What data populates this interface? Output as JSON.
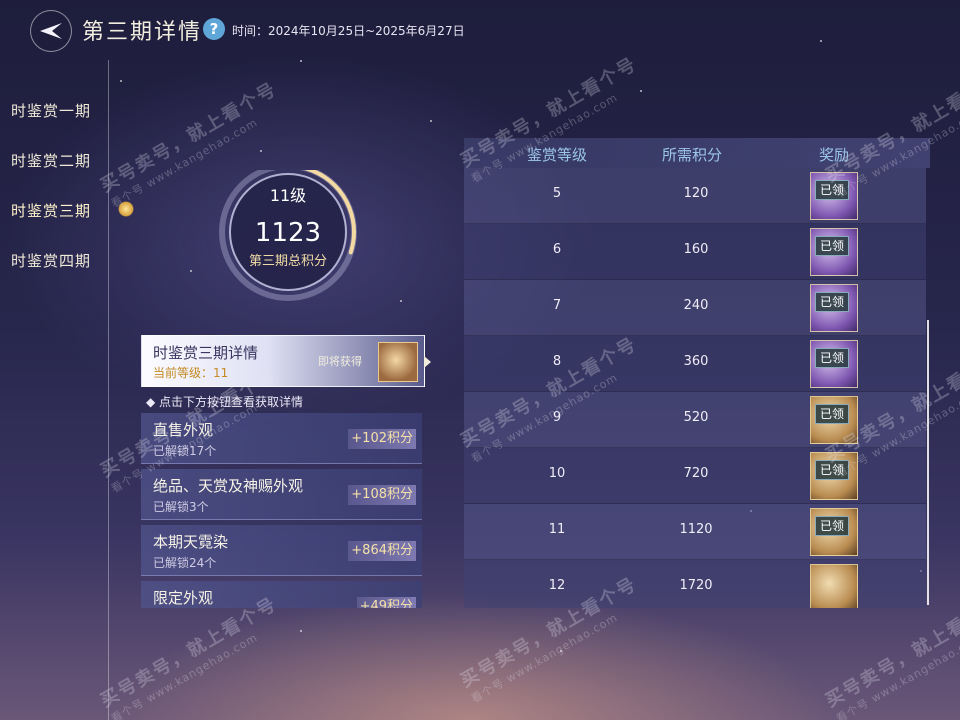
{
  "header": {
    "title": "第三期详情",
    "help_icon": "question-mark-icon",
    "period": "时间：2024年10月25日~2025年6月27日"
  },
  "nav": {
    "items": [
      {
        "label": "时鉴赏一期"
      },
      {
        "label": "时鉴赏二期"
      },
      {
        "label": "时鉴赏三期"
      },
      {
        "label": "时鉴赏四期"
      }
    ],
    "active_index": 2
  },
  "score": {
    "level": "11级",
    "value": "1123",
    "caption": "第三期总积分",
    "ring_progress": 0.3
  },
  "summary": {
    "title": "时鉴赏三期详情",
    "subtitle": "当前等级：11",
    "upcoming_label": "即将获得"
  },
  "hint": "点击下方按钮查看获取详情",
  "sources": [
    {
      "name": "直售外观",
      "unlocked": "已解锁17个",
      "points": "+102积分"
    },
    {
      "name": "绝品、天赏及神赐外观",
      "unlocked": "已解锁3个",
      "points": "+108积分"
    },
    {
      "name": "本期天霓染",
      "unlocked": "已解锁24个",
      "points": "+864积分"
    },
    {
      "name": "限定外观",
      "unlocked": "",
      "points": "+49积分"
    }
  ],
  "table": {
    "headers": [
      "鉴赏等级",
      "所需积分",
      "奖励"
    ],
    "rows": [
      {
        "level": "5",
        "points": "120",
        "reward": "purple",
        "status": "已领"
      },
      {
        "level": "6",
        "points": "160",
        "reward": "purple",
        "status": "已领"
      },
      {
        "level": "7",
        "points": "240",
        "reward": "purple",
        "status": "已领"
      },
      {
        "level": "8",
        "points": "360",
        "reward": "purple",
        "status": "已领"
      },
      {
        "level": "9",
        "points": "520",
        "reward": "gold",
        "status": "已领"
      },
      {
        "level": "10",
        "points": "720",
        "reward": "gold",
        "status": "已领"
      },
      {
        "level": "11",
        "points": "1120",
        "reward": "gold",
        "status": "已领"
      },
      {
        "level": "12",
        "points": "1720",
        "reward": "gold",
        "status": ""
      }
    ]
  },
  "watermark": {
    "text": "买号卖号，就上看个号",
    "url": "看个号 www.kangehao.com"
  }
}
